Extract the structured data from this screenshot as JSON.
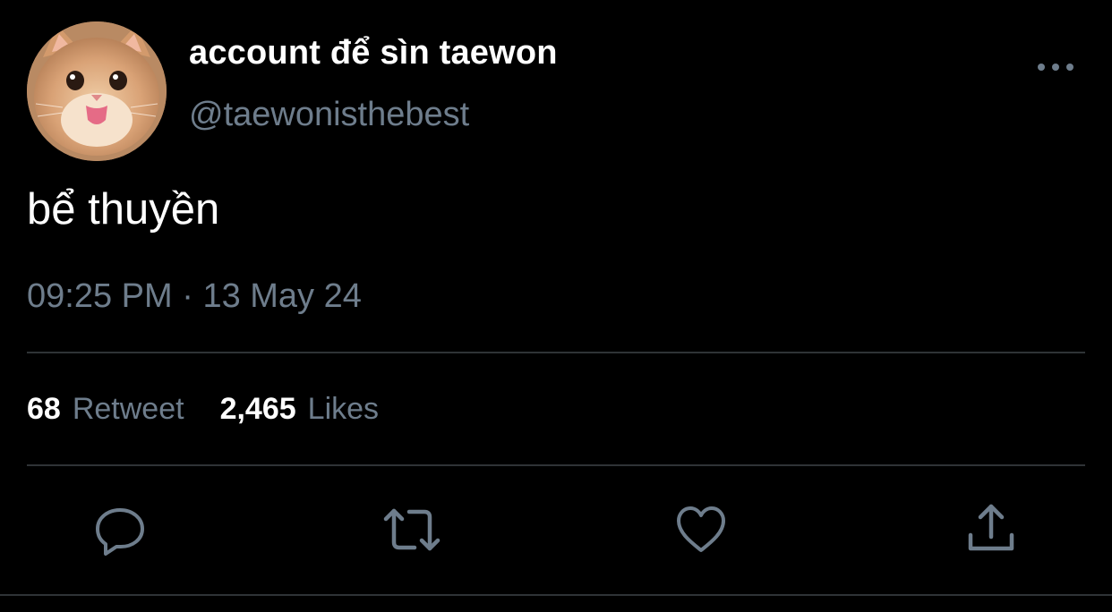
{
  "tweet": {
    "author": {
      "display_name": "account để sìn taewon",
      "handle": "@taewonisthebest",
      "avatar_icon": "cat-avatar"
    },
    "text": "bể thuyền",
    "time": "09:25 PM",
    "separator": "·",
    "date": "13 May 24",
    "retweet_count": "68",
    "retweet_label": "Retweet",
    "like_count": "2,465",
    "like_label": "Likes"
  },
  "actions": [
    {
      "icon": "reply-icon"
    },
    {
      "icon": "retweet-icon"
    },
    {
      "icon": "like-icon"
    },
    {
      "icon": "share-icon"
    }
  ],
  "colors": {
    "background": "#000000",
    "primary_text": "#ffffff",
    "secondary_text": "#6e7d8c",
    "divider": "#2f3336"
  }
}
